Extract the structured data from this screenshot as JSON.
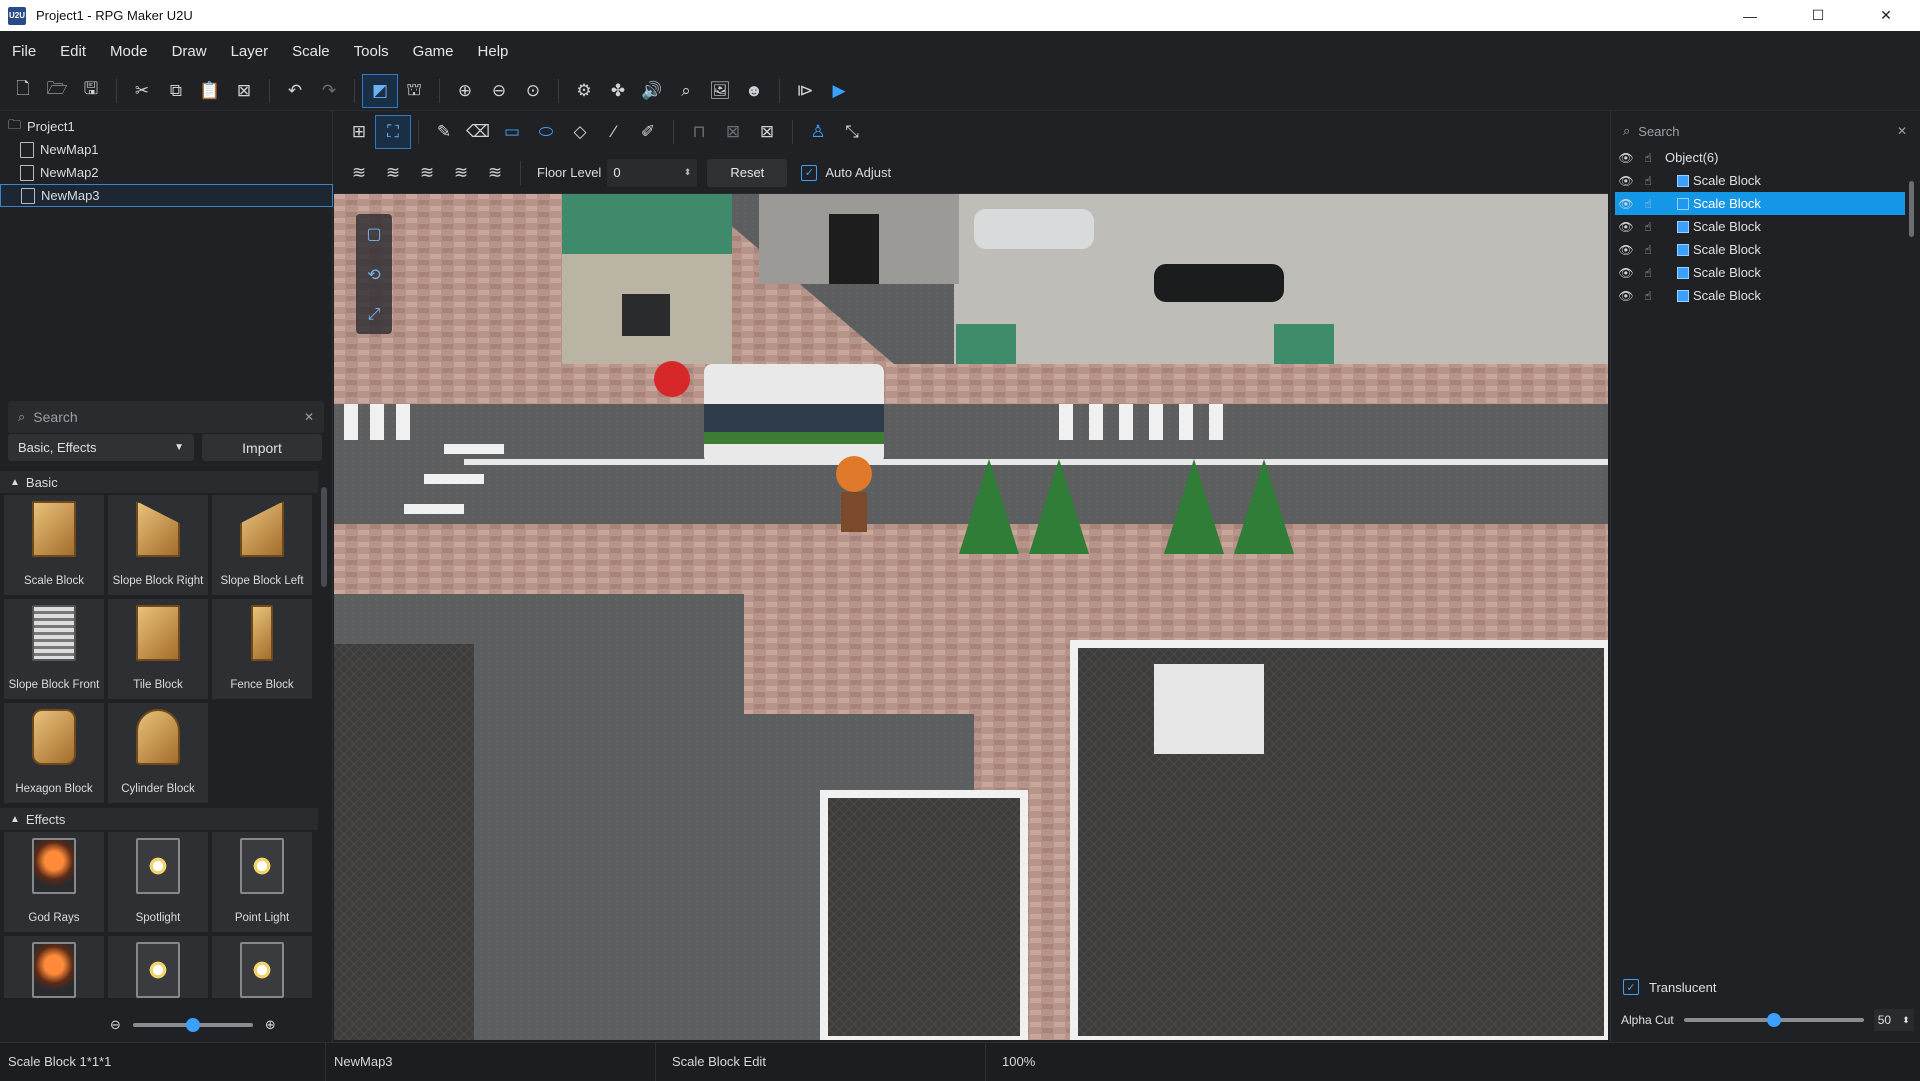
{
  "window": {
    "title": "Project1 - RPG Maker U2U",
    "app_icon": "U2U",
    "controls": [
      "—",
      "☐",
      "✕"
    ]
  },
  "menu": [
    "File",
    "Edit",
    "Mode",
    "Draw",
    "Layer",
    "Scale",
    "Tools",
    "Game",
    "Help"
  ],
  "project_tree": {
    "root": "Project1",
    "maps": [
      "NewMap1",
      "NewMap2",
      "NewMap3"
    ],
    "selected_map": "NewMap3"
  },
  "asset_panel": {
    "search_placeholder": "Search",
    "filter_value": "Basic, Effects",
    "import_label": "Import",
    "sections": [
      {
        "title": "Basic",
        "items": [
          "Scale Block",
          "Slope Block Right",
          "Slope Block Left",
          "Slope Block Front",
          "Tile Block",
          "Fence Block",
          "Hexagon Block",
          "Cylinder Block"
        ]
      },
      {
        "title": "Effects",
        "items": [
          "God Rays",
          "Spotlight",
          "Point Light",
          "",
          "",
          ""
        ]
      }
    ],
    "zoom_level": 0.5
  },
  "floor_bar": {
    "floor_label": "Floor Level",
    "floor_value": "0",
    "reset_label": "Reset",
    "auto_adjust_label": "Auto Adjust",
    "auto_adjust_checked": true
  },
  "object_panel": {
    "search_placeholder": "Search",
    "root_label": "Object(6)",
    "items": [
      {
        "label": "Scale Block",
        "checked": true,
        "selected": false
      },
      {
        "label": "Scale Block",
        "checked": false,
        "selected": true
      },
      {
        "label": "Scale Block",
        "checked": true,
        "selected": false
      },
      {
        "label": "Scale Block",
        "checked": true,
        "selected": false
      },
      {
        "label": "Scale Block",
        "checked": true,
        "selected": false
      },
      {
        "label": "Scale Block",
        "checked": true,
        "selected": false
      }
    ],
    "translucent_label": "Translucent",
    "translucent_checked": true,
    "alpha_label": "Alpha Cut",
    "alpha_value": "50"
  },
  "status": {
    "selection": "Scale Block 1*1*1",
    "map": "NewMap3",
    "mode": "Scale Block Edit",
    "zoom": "100%"
  },
  "colors": {
    "accent": "#3ba0ff",
    "selected_row": "#1597e8",
    "panel": "#202124"
  }
}
